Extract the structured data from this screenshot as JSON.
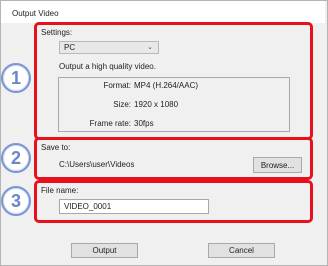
{
  "window": {
    "title": "Output Video"
  },
  "settings": {
    "label": "Settings:",
    "preset_value": "PC",
    "description": "Output a high quality video.",
    "format_label": "Format:",
    "format_value": "MP4 (H.264/AAC)",
    "size_label": "Size:",
    "size_value": "1920 x 1080",
    "framerate_label": "Frame rate:",
    "framerate_value": "30fps"
  },
  "save_to": {
    "label": "Save to:",
    "path": "C:\\Users\\user\\Videos",
    "browse_label": "Browse..."
  },
  "file_name": {
    "label": "File name:",
    "value": "VIDEO_0001"
  },
  "actions": {
    "output_label": "Output",
    "cancel_label": "Cancel"
  },
  "callouts": [
    "1",
    "2",
    "3"
  ],
  "colors": {
    "highlight": "#e8101c",
    "callout": "#6b86c9"
  }
}
